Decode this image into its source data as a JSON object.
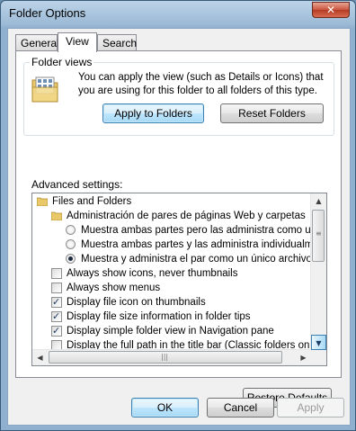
{
  "window": {
    "title": "Folder Options",
    "close_glyph": "✕"
  },
  "tabs": [
    {
      "label": "General"
    },
    {
      "label": "View"
    },
    {
      "label": "Search"
    }
  ],
  "folder_views": {
    "label": "Folder views",
    "description": "You can apply the view (such as Details or Icons) that you are using for this folder to all folders of this type.",
    "apply_button": "Apply to Folders",
    "reset_button": "Reset Folders",
    "icon": "folder-views-icon"
  },
  "advanced": {
    "label": "Advanced settings:",
    "items": [
      {
        "type": "folder",
        "label": "Files and Folders"
      },
      {
        "type": "folder",
        "label": "Administración de pares de páginas Web y carpetas"
      },
      {
        "type": "radio",
        "checked": false,
        "label": "Muestra ambas partes pero las administra como un único archivo"
      },
      {
        "type": "radio",
        "checked": false,
        "label": "Muestra ambas partes y las administra individualmente"
      },
      {
        "type": "radio",
        "checked": true,
        "label": "Muestra y administra el par como un único archivo"
      },
      {
        "type": "checkbox",
        "checked": false,
        "label": "Always show icons, never thumbnails"
      },
      {
        "type": "checkbox",
        "checked": false,
        "label": "Always show menus"
      },
      {
        "type": "checkbox",
        "checked": true,
        "label": "Display file icon on thumbnails"
      },
      {
        "type": "checkbox",
        "checked": true,
        "label": "Display file size information in folder tips"
      },
      {
        "type": "checkbox",
        "checked": true,
        "label": "Display simple folder view in Navigation pane"
      },
      {
        "type": "checkbox",
        "checked": false,
        "label": "Display the full path in the title bar (Classic folders only)"
      }
    ]
  },
  "restore_defaults_button": "Restore Defaults",
  "footer": {
    "ok": "OK",
    "cancel": "Cancel",
    "apply": "Apply"
  },
  "colors": {
    "accent": "#3c7fb1",
    "title_bar": "#9cbad6",
    "close": "#c9543d"
  }
}
